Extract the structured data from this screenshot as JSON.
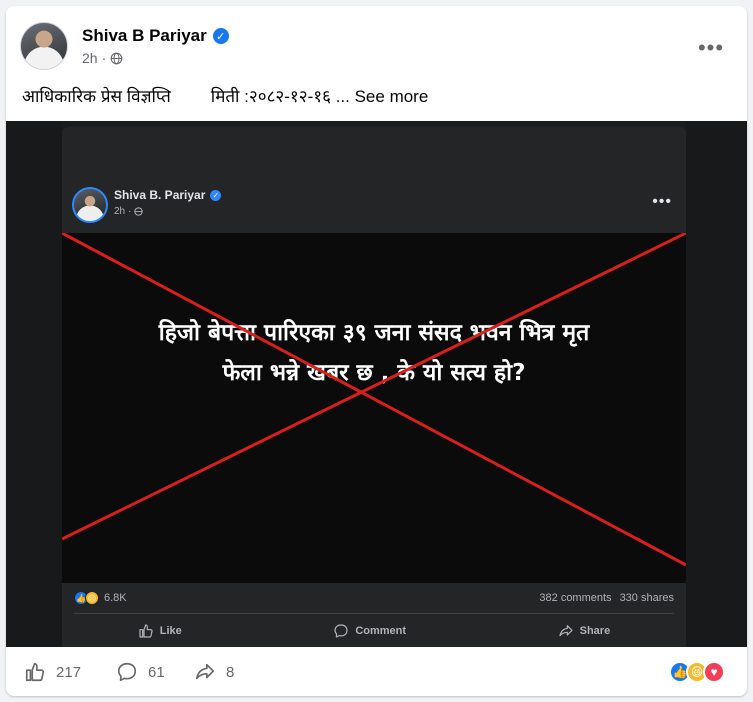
{
  "post": {
    "author": "Shiva B Pariyar",
    "timestamp": "2h",
    "text_title": "आधिकारिक प्रेस विज्ञप्ति",
    "text_date": "मिती :२०८२-१२-१६",
    "ellipsis": "...",
    "see_more": "See more",
    "more_icon": "more-horizontal-icon",
    "privacy_icon": "globe-icon"
  },
  "shared_image": {
    "author": "Shiva B. Pariyar",
    "timestamp": "2h",
    "headline_line1": "हिजो बेपत्ता पारिएका ३९ जना संसद भवन भित्र मृत",
    "headline_line2": "फेला भन्ने खबर छ , के यो सत्य हो?",
    "reaction_count": "6.8K",
    "comments": "382 comments",
    "shares": "330 shares",
    "actions": [
      "Like",
      "Comment",
      "Share"
    ],
    "overlay_color": "#d91e1e"
  },
  "footer": {
    "likes": "217",
    "comments": "61",
    "shares": "8"
  },
  "colors": {
    "brand_blue": "#1877f2",
    "love_red": "#f33e58",
    "haha_yellow": "#f7b928"
  }
}
